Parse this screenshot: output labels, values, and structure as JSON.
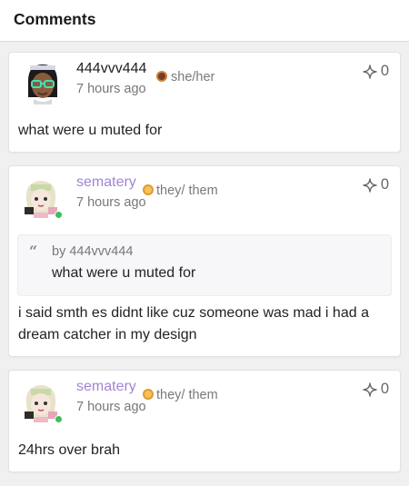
{
  "header": {
    "title": "Comments"
  },
  "colors": {
    "accent_purple": "#a483d4",
    "online_green": "#3cbf5a",
    "background": "#f0f0f1"
  },
  "comments": [
    {
      "username": "444vvv444",
      "pronouns": "she/her",
      "timestamp": "7 hours ago",
      "likes": "0",
      "body": "what were u muted for"
    },
    {
      "username": "sematery",
      "pronouns": "they/ them",
      "timestamp": "7 hours ago",
      "likes": "0",
      "quote": {
        "by": "by 444vvv444",
        "text": "what were u muted for"
      },
      "body": "i said smth es didnt like cuz someone was mad i had a dream catcher in my design"
    },
    {
      "username": "sematery",
      "pronouns": "they/ them",
      "timestamp": "7 hours ago",
      "likes": "0",
      "body": "24hrs over brah"
    }
  ]
}
